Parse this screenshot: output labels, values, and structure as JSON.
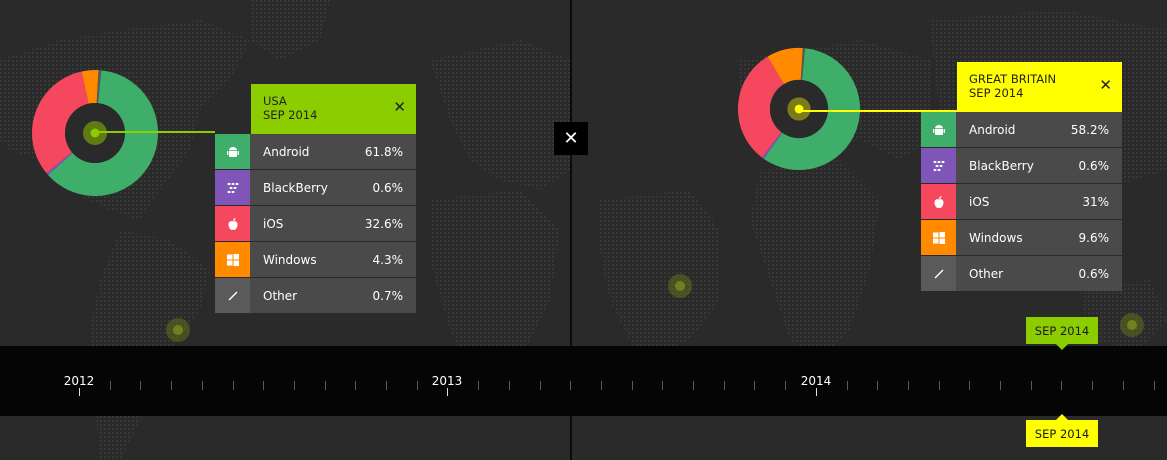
{
  "chart_data": [
    {
      "type": "pie",
      "variant": "donut",
      "title": "USA SEP 2014",
      "categories": [
        "Android",
        "BlackBerry",
        "iOS",
        "Windows",
        "Other"
      ],
      "values": [
        61.8,
        0.6,
        32.6,
        4.3,
        0.7
      ],
      "value_labels": [
        "61.8%",
        "0.6%",
        "32.6%",
        "4.3%",
        "0.7%"
      ],
      "unit": "%",
      "colors": [
        "#3fae6a",
        "#7f56b8",
        "#f5485e",
        "#ff8a00",
        "#5a5a5a"
      ]
    },
    {
      "type": "pie",
      "variant": "donut",
      "title": "GREAT BRITAIN SEP 2014",
      "categories": [
        "Android",
        "BlackBerry",
        "iOS",
        "Windows",
        "Other"
      ],
      "values": [
        58.2,
        0.6,
        31,
        9.6,
        0.6
      ],
      "value_labels": [
        "58.2%",
        "0.6%",
        "31%",
        "9.6%",
        "0.6%"
      ],
      "unit": "%",
      "colors": [
        "#3fae6a",
        "#7f56b8",
        "#f5485e",
        "#ff8a00",
        "#5a5a5a"
      ]
    }
  ],
  "panels": [
    {
      "country": "USA",
      "date": "SEP 2014",
      "accent": "#8ccd00",
      "close_label": "✕",
      "rows": [
        {
          "name": "Android",
          "value": "61.8%",
          "icon": "android-icon",
          "color": "#3fae6a"
        },
        {
          "name": "BlackBerry",
          "value": "0.6%",
          "icon": "blackberry-icon",
          "color": "#7f56b8"
        },
        {
          "name": "iOS",
          "value": "32.6%",
          "icon": "apple-icon",
          "color": "#f5485e"
        },
        {
          "name": "Windows",
          "value": "4.3%",
          "icon": "windows-icon",
          "color": "#ff8a00"
        },
        {
          "name": "Other",
          "value": "0.7%",
          "icon": "other-icon",
          "color": "#5a5a5a"
        }
      ]
    },
    {
      "country": "GREAT BRITAIN",
      "date": "SEP 2014",
      "accent": "#ffff00",
      "close_label": "✕",
      "rows": [
        {
          "name": "Android",
          "value": "58.2%",
          "icon": "android-icon",
          "color": "#3fae6a"
        },
        {
          "name": "BlackBerry",
          "value": "0.6%",
          "icon": "blackberry-icon",
          "color": "#7f56b8"
        },
        {
          "name": "iOS",
          "value": "31%",
          "icon": "apple-icon",
          "color": "#f5485e"
        },
        {
          "name": "Windows",
          "value": "9.6%",
          "icon": "windows-icon",
          "color": "#ff8a00"
        },
        {
          "name": "Other",
          "value": "0.6%",
          "icon": "other-icon",
          "color": "#5a5a5a"
        }
      ]
    }
  ],
  "center_close_label": "✕",
  "timeline": {
    "years": [
      "2012",
      "2013",
      "2014"
    ],
    "flags": [
      {
        "label": "SEP 2014",
        "color": "#8ccd00"
      },
      {
        "label": "SEP 2014",
        "color": "#ffff00"
      }
    ]
  }
}
